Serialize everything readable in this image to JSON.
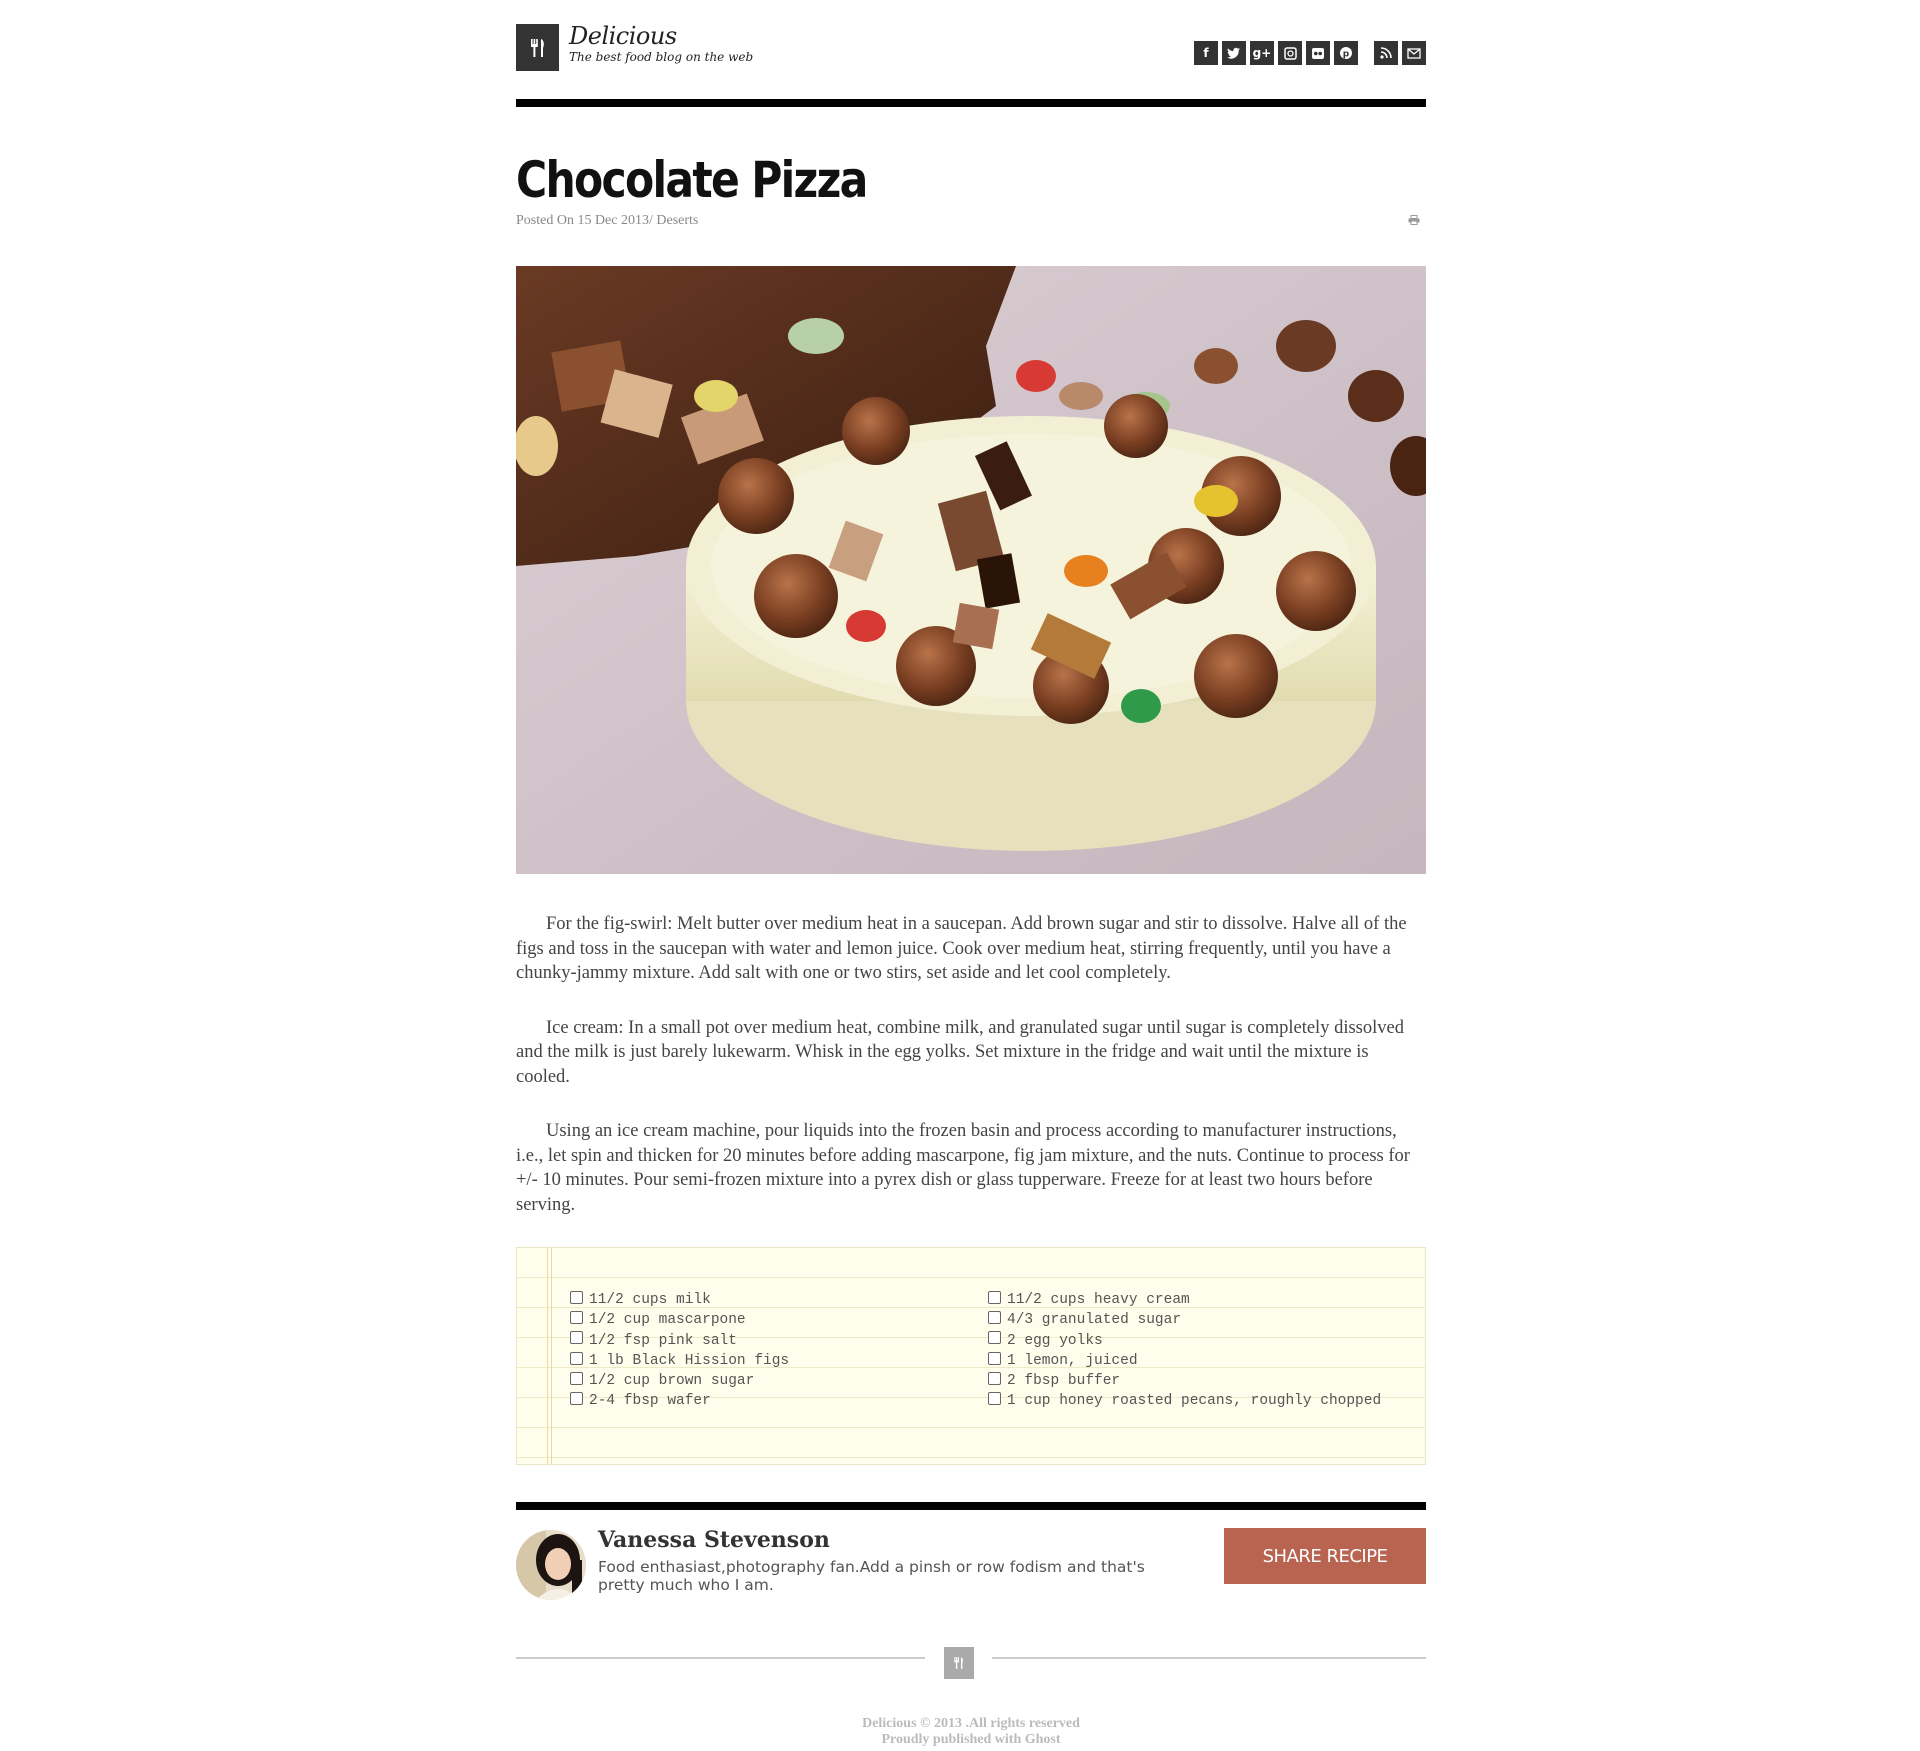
{
  "site": {
    "brand_name": "Delicious",
    "tagline": "The best food blog on the web"
  },
  "social_icons": [
    {
      "name": "facebook",
      "glyph": "f"
    },
    {
      "name": "twitter",
      "glyph": "t"
    },
    {
      "name": "google-plus",
      "glyph": "g+"
    },
    {
      "name": "instagram",
      "glyph": "◻"
    },
    {
      "name": "flickr",
      "glyph": "••"
    },
    {
      "name": "pinterest",
      "glyph": "p"
    },
    {
      "name": "rss",
      "glyph": "≈"
    },
    {
      "name": "email",
      "glyph": "✉"
    }
  ],
  "post": {
    "title": "Chocolate Pizza",
    "meta": "Posted On 15 Dec 2013/ Deserts",
    "paragraphs": [
      "For the fig-swirl: Melt butter over medium heat in a saucepan. Add brown sugar and stir to dissolve. Halve all of the figs and toss in the saucepan with water and lemon juice. Cook over medium heat, stirring frequently, until you have a chunky-jammy mixture. Add salt with one or two stirs, set aside and let cool completely.",
      "Ice cream: In a small pot over medium heat, combine milk, and granulated sugar until sugar is completely dissolved and the milk is just barely lukewarm. Whisk in the egg yolks. Set mixture in the fridge and wait until the mixture is cooled.",
      "Using an ice cream machine, pour liquids into the frozen basin and process according to manufacturer instructions, i.e., let spin and thicken for 20 minutes before adding mascarpone, fig jam mixture, and the nuts. Continue to process for +/- 10 minutes. Pour semi-frozen mixture into a pyrex dish or glass tupperware. Freeze for at least two hours before serving."
    ]
  },
  "ingredients": {
    "left": [
      "11/2 cups milk",
      "1/2 cup mascarpone",
      "1/2 fsp pink salt",
      "1 lb Black Hission figs",
      "1/2 cup brown sugar",
      "2-4 fbsp wafer"
    ],
    "right": [
      "11/2 cups heavy cream",
      "4/3 granulated sugar",
      "2 egg yolks",
      "1 lemon, juiced",
      "2 fbsp buffer",
      "1 cup honey roasted pecans, roughly chopped"
    ]
  },
  "author": {
    "name": "Vanessa Stevenson",
    "bio": "Food enthasiast,photography fan.Add a pinsh or row fodism and that's pretty much who I am."
  },
  "share_button": "SHARE RECIPE",
  "footer": {
    "line1": "Delicious © 2013 .All rights reserved",
    "line2": "Proudly published with Ghost"
  },
  "colors": {
    "accent": "#b96451",
    "dark": "#333333",
    "notepad_bg": "#fffdec"
  }
}
